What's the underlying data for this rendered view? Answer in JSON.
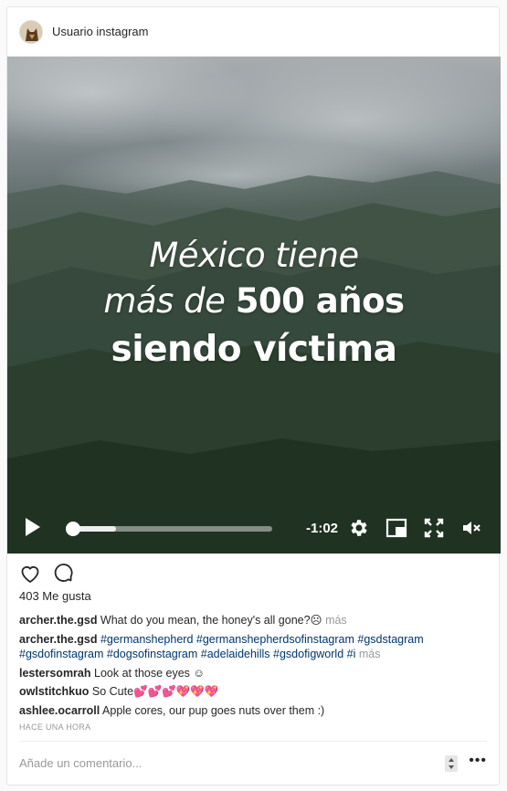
{
  "header": {
    "username": "Usuario instagram"
  },
  "video": {
    "overlay_line1": "México tiene",
    "overlay_line2_a": "más de ",
    "overlay_line2_b": "500 años",
    "overlay_line3": "siendo víctima",
    "time_remaining": "-1:02",
    "buffered_fraction": 0.24,
    "played_fraction": 0.03
  },
  "likes": {
    "text": "403 Me gusta"
  },
  "comments": [
    {
      "user": "archer.the.gsd",
      "text": " What do you mean, the honey's all gone?☹ ",
      "more": "más"
    },
    {
      "user": "archer.the.gsd",
      "tags": [
        "#germanshepherd",
        "#germanshepherdsofinstagram",
        "#gsdstagram",
        "#gsdofinstagram",
        "#dogsofinstagram",
        "#adelaidehills",
        "#gsdofigworld",
        "#i"
      ],
      "more": "más"
    },
    {
      "user": "lestersomrah",
      "text": " Look at those eyes ☺"
    },
    {
      "user": "owlstitchkuo",
      "text": " So Cute💕💕💕💖💖💖"
    },
    {
      "user": "ashlee.ocarroll",
      "text": " Apple cores, our pup goes nuts over them :)"
    }
  ],
  "time_ago": "HACE UNA HORA",
  "add_comment": {
    "placeholder": "Añade un comentario..."
  },
  "options_label": "•••",
  "colors": {
    "link": "#003569",
    "muted": "#999999",
    "text": "#262626"
  }
}
